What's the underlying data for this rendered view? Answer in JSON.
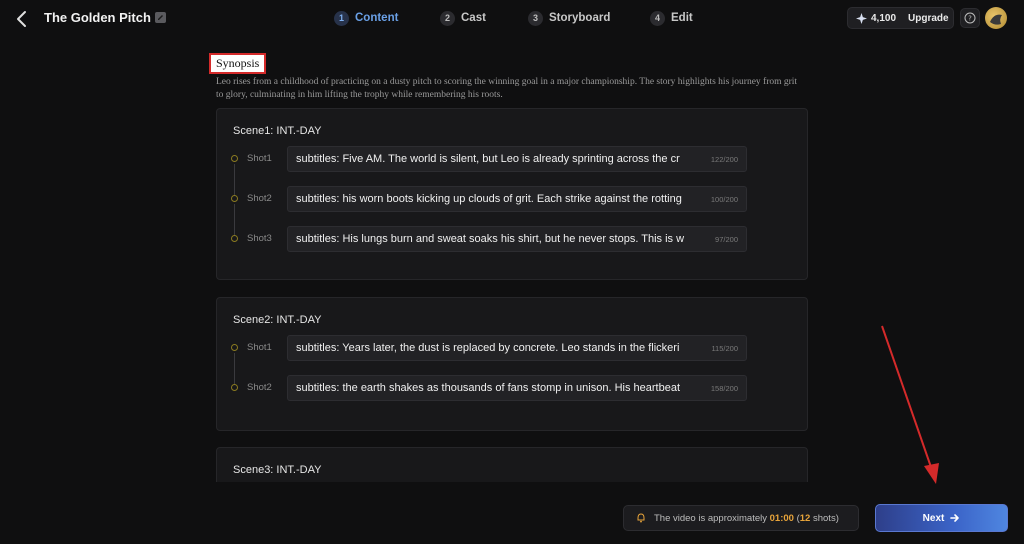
{
  "header": {
    "project_title": "The Golden Pitch",
    "steps": [
      {
        "num": "1",
        "label": "Content"
      },
      {
        "num": "2",
        "label": "Cast"
      },
      {
        "num": "3",
        "label": "Storyboard"
      },
      {
        "num": "4",
        "label": "Edit"
      }
    ],
    "active_step": "Content",
    "credits": "4,100",
    "upgrade_label": "Upgrade"
  },
  "synopsis": {
    "title": "Synopsis",
    "text": "Leo rises from a childhood of practicing on a dusty pitch to scoring the winning goal in a major championship. The story highlights his journey from grit to glory, culminating in him lifting the trophy while remembering his roots."
  },
  "scenes": [
    {
      "title": "Scene1: INT.-DAY",
      "shots": [
        {
          "label": "Shot1",
          "text": "subtitles:   Five AM. The world is silent, but Leo is already sprinting across the cr",
          "count": "122/200"
        },
        {
          "label": "Shot2",
          "text": "subtitles:   his worn boots kicking up clouds of grit. Each strike against the rotting",
          "count": "100/200"
        },
        {
          "label": "Shot3",
          "text": "subtitles:   His lungs burn and sweat soaks his shirt, but he never stops. This is w",
          "count": "97/200"
        }
      ]
    },
    {
      "title": "Scene2: INT.-DAY",
      "shots": [
        {
          "label": "Shot1",
          "text": "subtitles:   Years later, the dust is replaced by concrete. Leo stands in the flickeri",
          "count": "115/200"
        },
        {
          "label": "Shot2",
          "text": "subtitles:   the earth shakes as thousands of fans stomp in unison. His heartbeat",
          "count": "158/200"
        }
      ]
    },
    {
      "title": "Scene3: INT.-DAY",
      "shots": []
    }
  ],
  "footer": {
    "info_prefix": "The video is approximately ",
    "duration": "01:00",
    "paren_open": " (",
    "shots_count": "12",
    "shots_suffix": " shots)",
    "next_label": "Next"
  },
  "colors": {
    "accent": "#6aa0e6",
    "highlight": "#e8a43a",
    "annotation": "#d42a2a"
  }
}
